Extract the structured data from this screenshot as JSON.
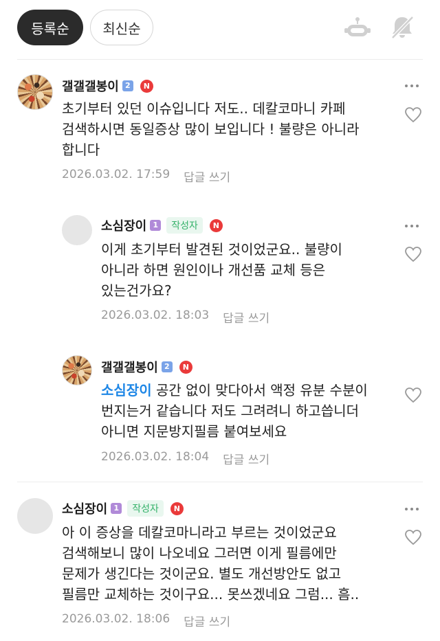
{
  "sort": {
    "registered": "등록순",
    "latest": "최신순"
  },
  "comments": [
    {
      "author": "갤갤갤봉이",
      "level": "2",
      "new_badge": "N",
      "text": [
        "초기부터 있던 이슈입니다 저도.. 데칼코마니 카페",
        "검색하시면 동일증상 많이 보입니다 ! 불량은 아니라",
        "합니다"
      ],
      "date": "2026.03.02. 17:59",
      "reply": "답글 쓰기"
    },
    {
      "author": "소심장이",
      "level": "1",
      "author_badge": "작성자",
      "new_badge": "N",
      "text": [
        "이게 초기부터 발견된 것이었군요.. 불량이",
        "아니라 하면 원인이나 개선품 교체 등은",
        "있는건가요?"
      ],
      "date": "2026.03.02. 18:03",
      "reply": "답글 쓰기"
    },
    {
      "author": "갤갤갤봉이",
      "level": "2",
      "new_badge": "N",
      "mention": "소심장이",
      "text": [
        "공간 없이 맞다아서 액정 유분 수분이",
        "번지는거 같습니다 저도 그려려니 하고씁니더",
        "아니면 지문방지필름 붙여보세요"
      ],
      "date": "2026.03.02. 18:04",
      "reply": "답글 쓰기"
    },
    {
      "author": "소심장이",
      "level": "1",
      "author_badge": "작성자",
      "new_badge": "N",
      "text": [
        "아 이 증상을 데칼코마니라고 부르는 것이었군요",
        "검색해보니 많이 나오네요 그러면 이게 필름에만",
        "문제가 생긴다는 것이군요. 별도 개선방안도 없고",
        "필름만 교체하는 것이구요... 못쓰겠네요 그럼... 흠.."
      ],
      "date": "2026.03.02. 18:06",
      "reply": "답글 쓰기"
    }
  ],
  "icons": {
    "robot": "robot-icon",
    "bell_off": "bell-off-icon",
    "more": "more-icon",
    "heart": "heart-icon"
  }
}
